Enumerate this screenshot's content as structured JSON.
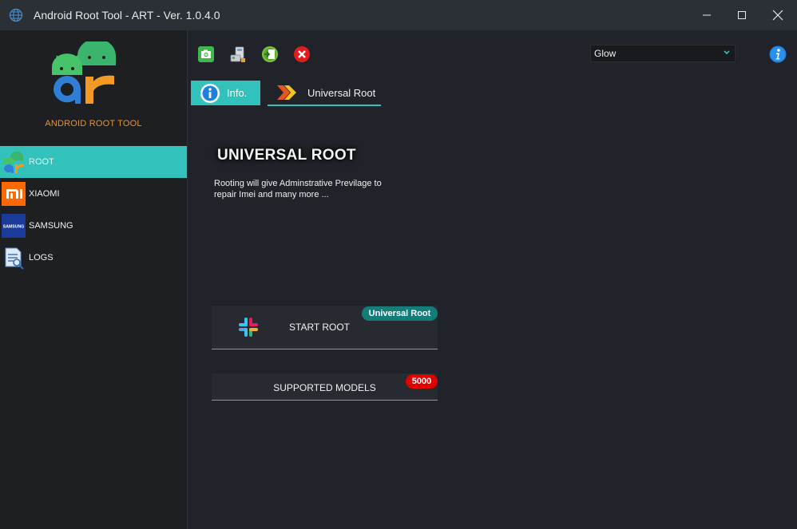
{
  "window": {
    "title": "Android Root Tool - ART - Ver. 1.0.4.0",
    "controls": [
      "minimize",
      "maximize",
      "close"
    ]
  },
  "sidebar": {
    "logo_caption": "ANDROID ROOT TOOL",
    "items": [
      {
        "label": "ROOT",
        "icon": "android-root-icon",
        "active": true
      },
      {
        "label": "XIAOMI",
        "icon": "xiaomi-icon",
        "active": false
      },
      {
        "label": "SAMSUNG",
        "icon": "samsung-icon",
        "active": false
      },
      {
        "label": "LOGS",
        "icon": "logs-icon",
        "active": false
      }
    ]
  },
  "toolbar": {
    "icons": [
      "camera-icon",
      "device-manager-icon",
      "export-icon",
      "exit-icon"
    ],
    "theme_select": {
      "value": "Glow"
    },
    "info_icon": "info-icon"
  },
  "tabs": [
    {
      "label": "Info.",
      "active": true
    },
    {
      "label": "Universal Root",
      "active": false
    }
  ],
  "main": {
    "heading": "UNIVERSAL ROOT",
    "description": "Rooting will give Adminstrative Previlage to repair Imei and many more ...",
    "start_button": {
      "label": "START ROOT",
      "badge": "Universal Root"
    },
    "models_button": {
      "label": "SUPPORTED MODELS",
      "badge": "5000"
    }
  },
  "colors": {
    "accent": "#33c1bb",
    "logo_text": "#f0902a",
    "badge_teal": "#137d7a",
    "badge_red": "#e00000",
    "background": "#202329"
  }
}
